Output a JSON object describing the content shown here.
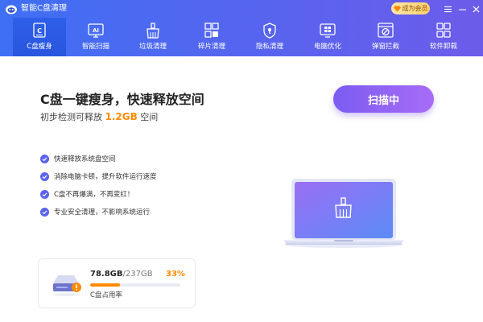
{
  "app": {
    "title": "智能C盘清理"
  },
  "titlebar": {
    "vip_label": "成为会员"
  },
  "nav": {
    "tabs": [
      {
        "label": "C盘瘦身",
        "icon": "c-drive-icon",
        "active": true
      },
      {
        "label": "智能扫描",
        "icon": "ai-scan-icon",
        "active": false
      },
      {
        "label": "垃圾清理",
        "icon": "broom-icon",
        "active": false
      },
      {
        "label": "碎片清理",
        "icon": "fragments-icon",
        "active": false
      },
      {
        "label": "隐私清理",
        "icon": "privacy-shield-icon",
        "active": false
      },
      {
        "label": "电脑优化",
        "icon": "windows-optimize-icon",
        "active": false
      },
      {
        "label": "弹窗拦截",
        "icon": "popup-block-icon",
        "active": false
      },
      {
        "label": "软件卸载",
        "icon": "apps-uninstall-icon",
        "active": false
      }
    ]
  },
  "main": {
    "headline": "C盘一键瘦身，快速释放空间",
    "sub_prefix": "初步检测可释放",
    "sub_value": "1.2GB",
    "sub_suffix": "空间",
    "scan_label": "扫描中",
    "features": [
      "快速释放系统盘空间",
      "消除电脑卡顿，提升软件运行速度",
      "C盘不再爆满，不再变红！",
      "专业安全清理，不影响系统运行"
    ]
  },
  "disk": {
    "used": "78.8GB",
    "total": "237GB",
    "percent_label": "33%",
    "usage_fraction": 0.33,
    "label": "C盘占用率"
  },
  "colors": {
    "header_start": "#3e6ff4",
    "header_end": "#6c5cea",
    "accent_orange": "#ff8a00",
    "scan_start": "#7b5cf2",
    "scan_end": "#a86cf6"
  }
}
